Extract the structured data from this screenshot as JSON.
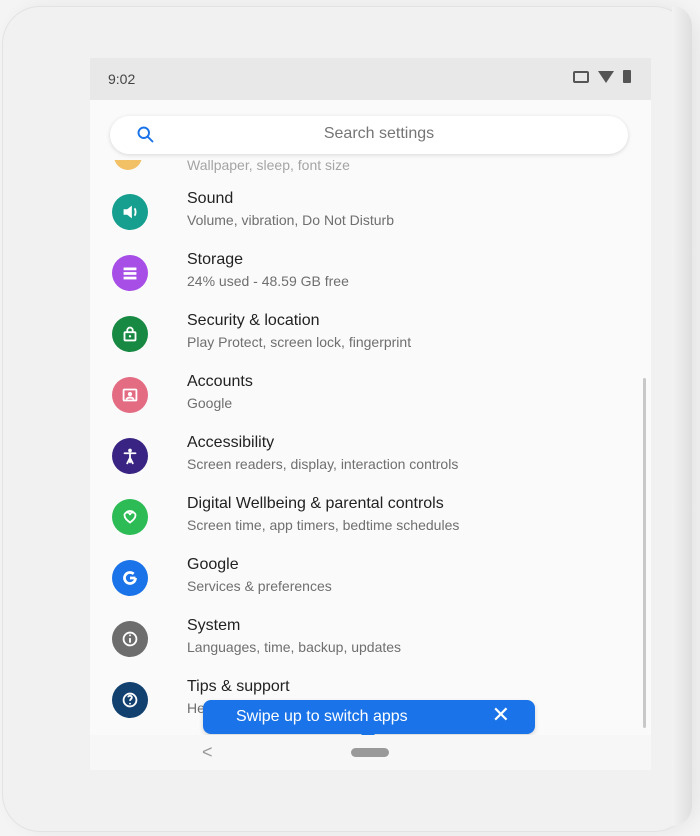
{
  "status": {
    "time": "9:02",
    "icons": [
      "cast-icon",
      "wifi-icon",
      "battery-icon"
    ]
  },
  "search": {
    "placeholder": "Search settings",
    "icon": "search-icon"
  },
  "partial_item": {
    "subtitle": "Wallpaper, sleep, font size",
    "color": "#f0b54a"
  },
  "items": [
    {
      "title": "Sound",
      "subtitle": "Volume, vibration, Do Not Disturb",
      "icon": "sound-icon",
      "color": "#169f8f"
    },
    {
      "title": "Storage",
      "subtitle": "24% used - 48.59 GB free",
      "icon": "storage-icon",
      "color": "#a64ee6"
    },
    {
      "title": "Security & location",
      "subtitle": "Play Protect, screen lock, fingerprint",
      "icon": "lock-icon",
      "color": "#178942"
    },
    {
      "title": "Accounts",
      "subtitle": "Google",
      "icon": "accounts-icon",
      "color": "#e36b82"
    },
    {
      "title": "Accessibility",
      "subtitle": "Screen readers, display, interaction controls",
      "icon": "accessibility-icon",
      "color": "#3a2483"
    },
    {
      "title": "Digital Wellbeing & parental controls",
      "subtitle": "Screen time, app timers, bedtime schedules",
      "icon": "wellbeing-icon",
      "color": "#2dbb55"
    },
    {
      "title": "Google",
      "subtitle": "Services & preferences",
      "icon": "google-icon",
      "color": "#1a73e8"
    },
    {
      "title": "System",
      "subtitle": "Languages, time, backup, updates",
      "icon": "info-icon",
      "color": "#6d6d6d"
    },
    {
      "title": "Tips & support",
      "subtitle": "He",
      "icon": "help-icon",
      "color": "#12416f"
    }
  ],
  "toast": {
    "text": "Swipe up to switch apps",
    "close_label": "✕",
    "color": "#1a73e8"
  },
  "nav": {
    "back_label": "<"
  }
}
